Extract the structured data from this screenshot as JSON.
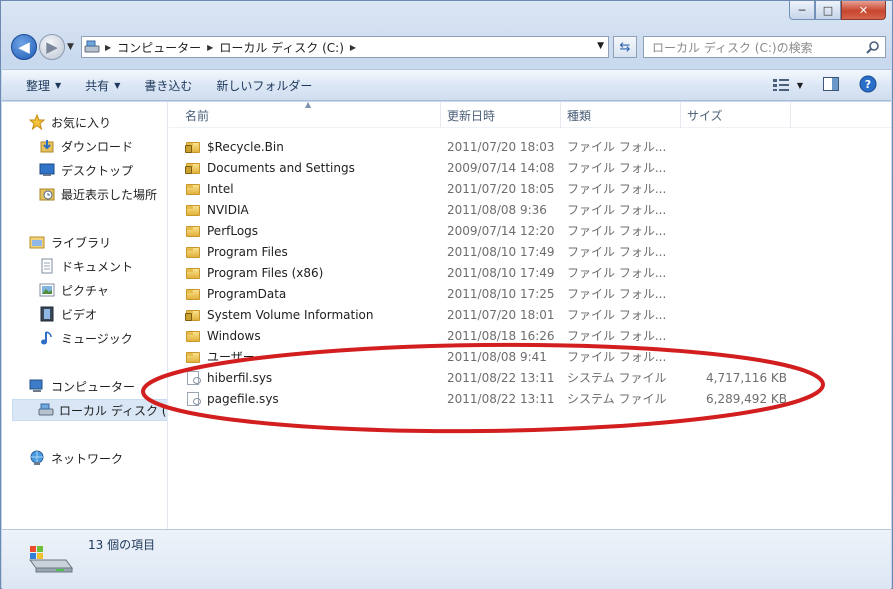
{
  "window": {
    "caption_min": "─",
    "caption_max": "□",
    "caption_close": "✕"
  },
  "address": {
    "crumbs": [
      "コンピューター",
      "ローカル ディスク (C:)"
    ],
    "search_placeholder": "ローカル ディスク (C:)の検索"
  },
  "toolbar": {
    "organize": "整理",
    "share": "共有",
    "burn": "書き込む",
    "new_folder": "新しいフォルダー"
  },
  "sidebar": {
    "favorites": "お気に入り",
    "downloads": "ダウンロード",
    "desktop": "デスクトップ",
    "recent": "最近表示した場所",
    "libraries": "ライブラリ",
    "documents": "ドキュメント",
    "pictures": "ピクチャ",
    "videos": "ビデオ",
    "music": "ミュージック",
    "computer": "コンピューター",
    "local_disk": "ローカル ディスク (C:)",
    "network": "ネットワーク"
  },
  "columns": {
    "name": "名前",
    "date": "更新日時",
    "type": "種類",
    "size": "サイズ"
  },
  "files": [
    {
      "name": "$Recycle.Bin",
      "date": "2011/07/20 18:03",
      "type": "ファイル フォル...",
      "size": "",
      "icon": "locked-folder-icon"
    },
    {
      "name": "Documents and Settings",
      "date": "2009/07/14 14:08",
      "type": "ファイル フォル...",
      "size": "",
      "icon": "locked-folder-icon"
    },
    {
      "name": "Intel",
      "date": "2011/07/20 18:05",
      "type": "ファイル フォル...",
      "size": "",
      "icon": "folder-icon"
    },
    {
      "name": "NVIDIA",
      "date": "2011/08/08 9:36",
      "type": "ファイル フォル...",
      "size": "",
      "icon": "folder-icon"
    },
    {
      "name": "PerfLogs",
      "date": "2009/07/14 12:20",
      "type": "ファイル フォル...",
      "size": "",
      "icon": "folder-icon"
    },
    {
      "name": "Program Files",
      "date": "2011/08/10 17:49",
      "type": "ファイル フォル...",
      "size": "",
      "icon": "folder-icon"
    },
    {
      "name": "Program Files (x86)",
      "date": "2011/08/10 17:49",
      "type": "ファイル フォル...",
      "size": "",
      "icon": "folder-icon"
    },
    {
      "name": "ProgramData",
      "date": "2011/08/10 17:25",
      "type": "ファイル フォル...",
      "size": "",
      "icon": "folder-icon"
    },
    {
      "name": "System Volume Information",
      "date": "2011/07/20 18:01",
      "type": "ファイル フォル...",
      "size": "",
      "icon": "locked-folder-icon"
    },
    {
      "name": "Windows",
      "date": "2011/08/18 16:26",
      "type": "ファイル フォル...",
      "size": "",
      "icon": "folder-icon"
    },
    {
      "name": "ユーザー",
      "date": "2011/08/08 9:41",
      "type": "ファイル フォル...",
      "size": "",
      "icon": "folder-icon"
    },
    {
      "name": "hiberfil.sys",
      "date": "2011/08/22 13:11",
      "type": "システム ファイル",
      "size": "4,717,116 KB",
      "icon": "system-file-icon"
    },
    {
      "name": "pagefile.sys",
      "date": "2011/08/22 13:11",
      "type": "システム ファイル",
      "size": "6,289,492 KB",
      "icon": "system-file-icon"
    }
  ],
  "status": {
    "item_count": "13 個の項目"
  },
  "colors": {
    "annotation": "#d21e1e",
    "folder": "#e2b23c"
  }
}
